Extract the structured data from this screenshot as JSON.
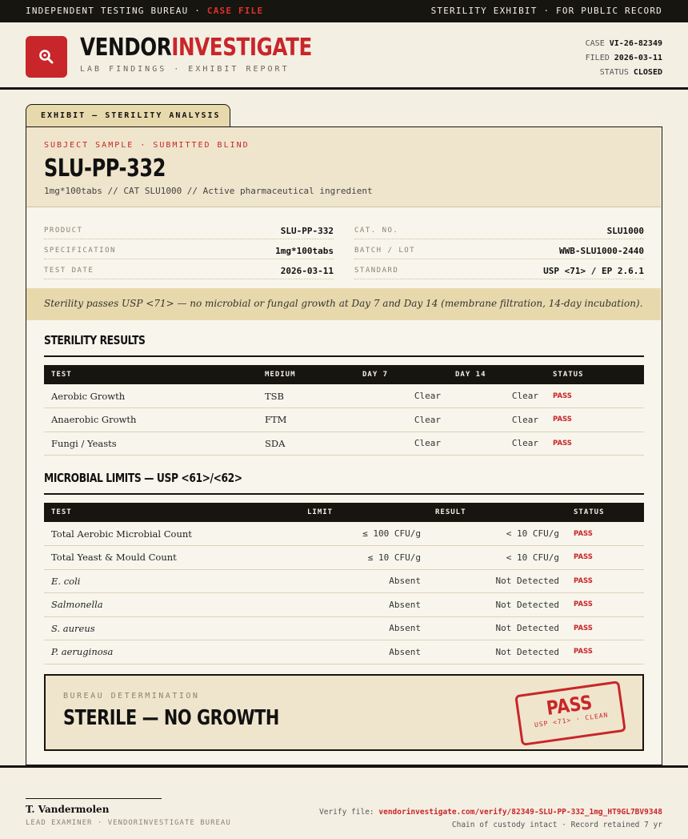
{
  "topbar": {
    "left_text": "INDEPENDENT TESTING BUREAU ·",
    "left_highlight": "CASE FILE",
    "right_text": "STERILITY EXHIBIT · FOR PUBLIC RECORD"
  },
  "header": {
    "brand_part1": "VENDOR",
    "brand_part2": "INVESTIGATE",
    "subtitle": "LAB FINDINGS · EXHIBIT REPORT",
    "case_label": "CASE",
    "case_value": "VI-26-82349",
    "filed_label": "FILED",
    "filed_value": "2026-03-11",
    "status_label": "STATUS",
    "status_value": "CLOSED"
  },
  "exhibit": {
    "tab_label": "EXHIBIT — STERILITY ANALYSIS",
    "subject_kicker": "SUBJECT SAMPLE · SUBMITTED BLIND",
    "subject_title": "SLU-PP-332",
    "subject_desc": "1mg*100tabs  //  CAT SLU1000  //  Active pharmaceutical ingredient",
    "fields": [
      {
        "label": "PRODUCT",
        "value": "SLU-PP-332"
      },
      {
        "label": "SPECIFICATION",
        "value": "1mg*100tabs"
      },
      {
        "label": "TEST DATE",
        "value": "2026-03-11"
      },
      {
        "label": "CAT. NO.",
        "value": "SLU1000"
      },
      {
        "label": "BATCH / LOT",
        "value": "WWB-SLU1000-2440"
      },
      {
        "label": "STANDARD",
        "value": "USP <71> / EP 2.6.1"
      }
    ],
    "note": "Sterility passes USP <71> — no microbial or fungal growth at Day 7 and Day 14 (membrane filtration, 14-day incubation)."
  },
  "sterility": {
    "title": "STERILITY RESULTS",
    "headers": [
      "TEST",
      "MEDIUM",
      "DAY 7",
      "DAY 14",
      "STATUS"
    ],
    "rows": [
      {
        "test": "Aerobic Growth",
        "medium": "TSB",
        "day7": "Clear",
        "day14": "Clear",
        "status": "PASS"
      },
      {
        "test": "Anaerobic Growth",
        "medium": "FTM",
        "day7": "Clear",
        "day14": "Clear",
        "status": "PASS"
      },
      {
        "test": "Fungi / Yeasts",
        "medium": "SDA",
        "day7": "Clear",
        "day14": "Clear",
        "status": "PASS"
      }
    ]
  },
  "microbial": {
    "title": "MICROBIAL LIMITS — USP <61>/<62>",
    "headers": [
      "TEST",
      "LIMIT",
      "RESULT",
      "STATUS"
    ],
    "rows": [
      {
        "test": "Total Aerobic Microbial Count",
        "limit": "≤ 100 CFU/g",
        "result": "< 10 CFU/g",
        "status": "PASS"
      },
      {
        "test": "Total Yeast & Mould Count",
        "limit": "≤ 10 CFU/g",
        "result": "< 10 CFU/g",
        "status": "PASS"
      },
      {
        "test": "E. coli",
        "limit": "Absent",
        "result": "Not Detected",
        "status": "PASS"
      },
      {
        "test": "Salmonella",
        "limit": "Absent",
        "result": "Not Detected",
        "status": "PASS"
      },
      {
        "test": "S. aureus",
        "limit": "Absent",
        "result": "Not Detected",
        "status": "PASS"
      },
      {
        "test": "P. aeruginosa",
        "limit": "Absent",
        "result": "Not Detected",
        "status": "PASS"
      }
    ]
  },
  "determination": {
    "kicker": "BUREAU DETERMINATION",
    "title": "STERILE — NO GROWTH",
    "stamp_main": "PASS",
    "stamp_sub": "USP <71> · CLEAN"
  },
  "footer": {
    "examiner_name": "T. Vandermolen",
    "examiner_role": "LEAD EXAMINER · VENDORINVESTIGATE BUREAU",
    "verify_label": "Verify file:",
    "verify_url": "vendorinvestigate.com/verify/82349-SLU-PP-332_1mg_HT9GL7BV9348",
    "custody": "Chain of custody intact · Record retained 7 yr"
  },
  "colors": {
    "accent": "#c8262a",
    "ink": "#17150f",
    "paper": "#f4efe3",
    "tan": "#e8d9ac"
  },
  "icons": {
    "logo": "magnifier-icon"
  }
}
